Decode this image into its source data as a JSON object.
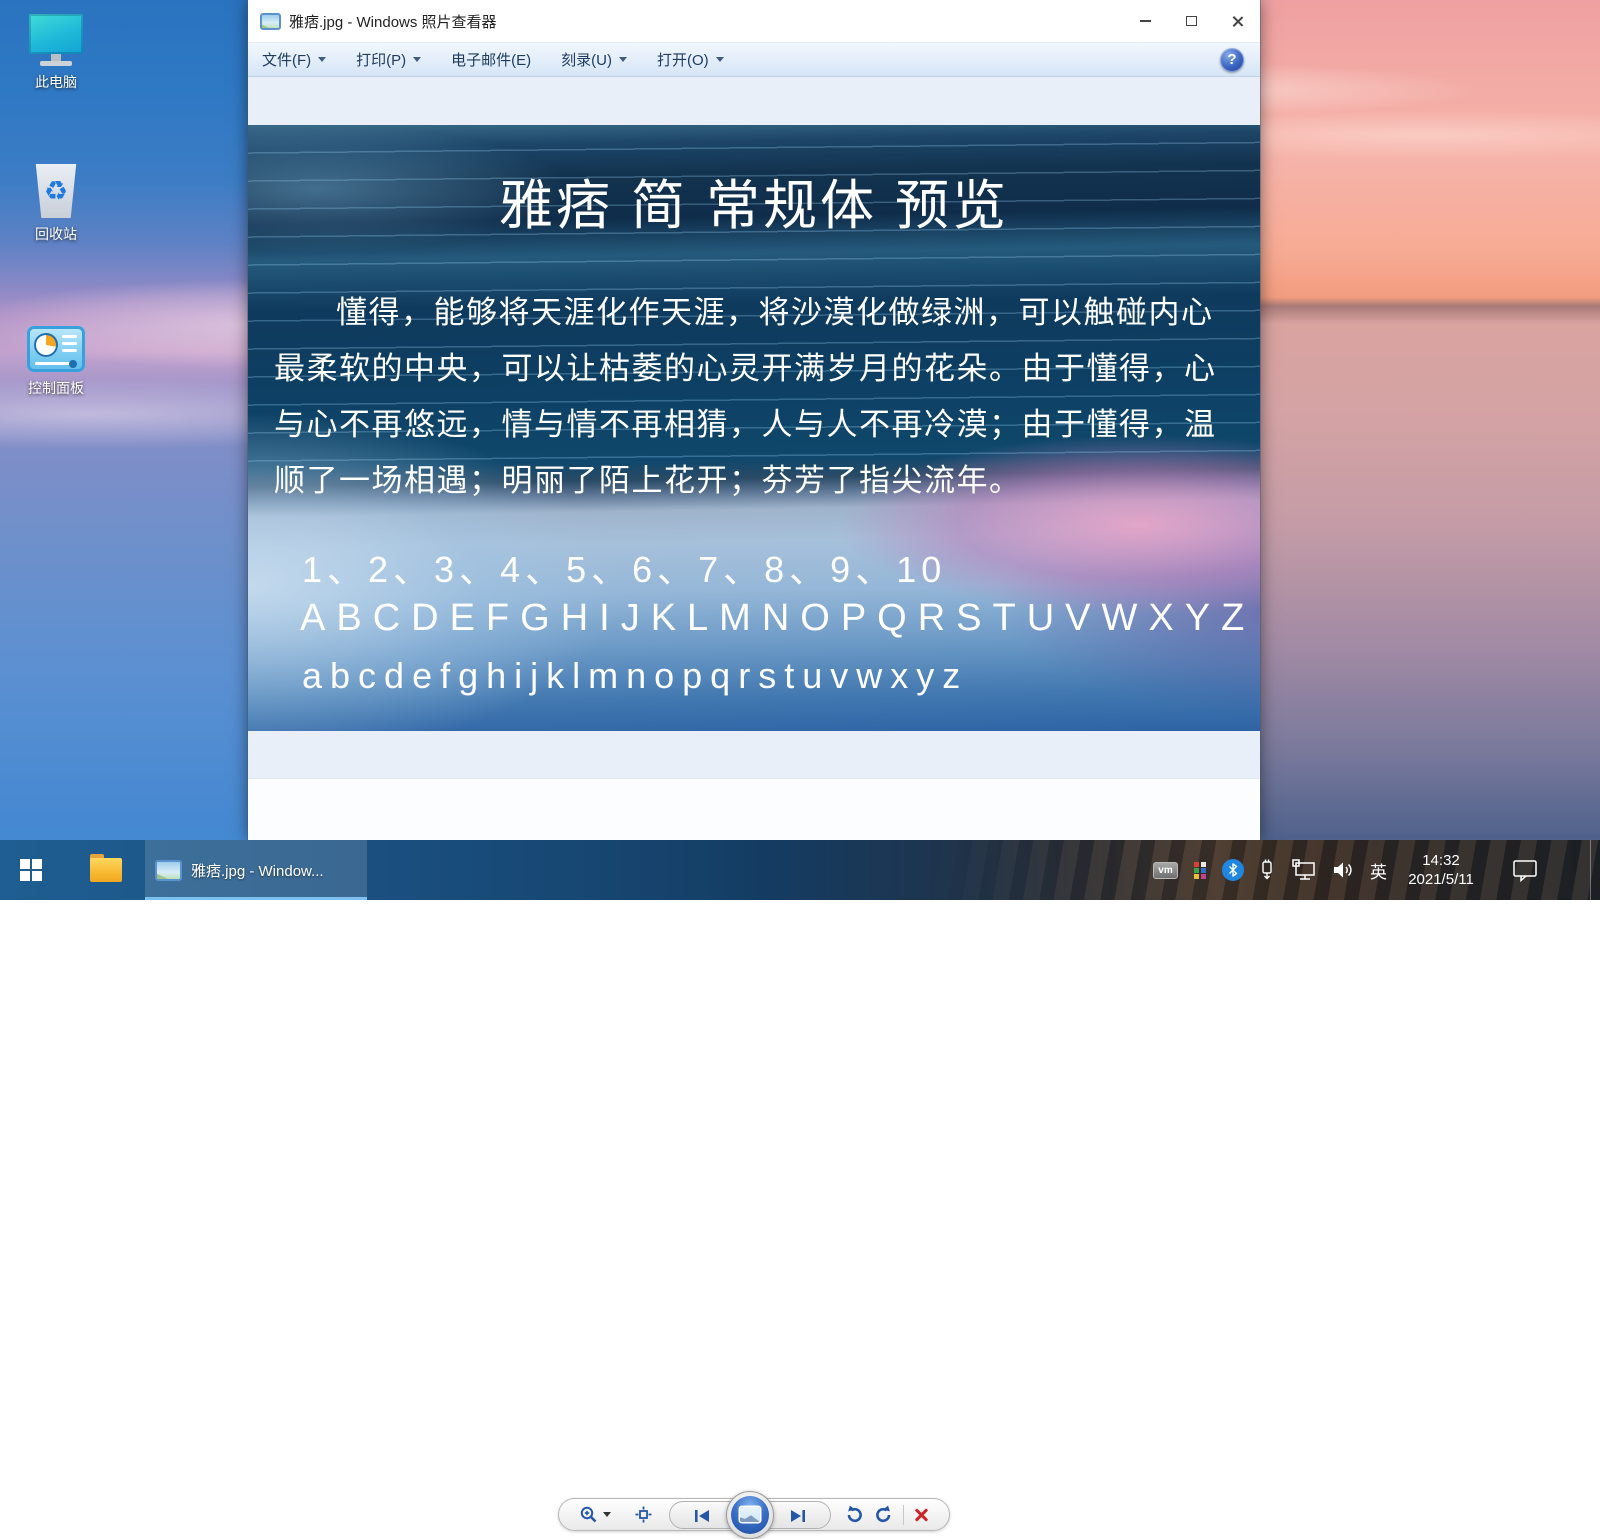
{
  "desktop": {
    "icons": [
      {
        "label": "此电脑"
      },
      {
        "label": "回收站"
      },
      {
        "label": "控制面板"
      }
    ]
  },
  "window": {
    "title": "雅痞.jpg - Windows 照片查看器",
    "menu": {
      "file": "文件(F)",
      "print": "打印(P)",
      "email": "电子邮件(E)",
      "burn": "刻录(U)",
      "open": "打开(O)"
    },
    "help": "?"
  },
  "photo": {
    "heading": "雅痞 简 常规体 预览",
    "lines": [
      "懂得，能够将天涯化作天涯，将沙漠化做绿洲，可以触碰内心",
      "最柔软的中央，可以让枯萎的心灵开满岁月的花朵。由于懂得，心",
      "与心不再悠远，情与情不再相猜，人与人不再冷漠；由于懂得，温",
      "顺了一场相遇；明丽了陌上花开；芬芳了指尖流年。"
    ],
    "numbers": "1、2、3、4、5、6、7、8、9、10",
    "uppercase": "ABCDEFGHIJKLMNOPQRSTUVWXYZ",
    "lowercase": "abcdefghijklmnopqrstuvwxyz"
  },
  "taskbar": {
    "task_label": "雅痞.jpg - Window...",
    "vm": "vm",
    "input_method": "英",
    "time": "14:32",
    "date": "2021/5/11"
  },
  "colors": {
    "accent_blue": "#2457a8",
    "delete_red": "#cc2525",
    "task_underline": "#7cc0f0"
  }
}
